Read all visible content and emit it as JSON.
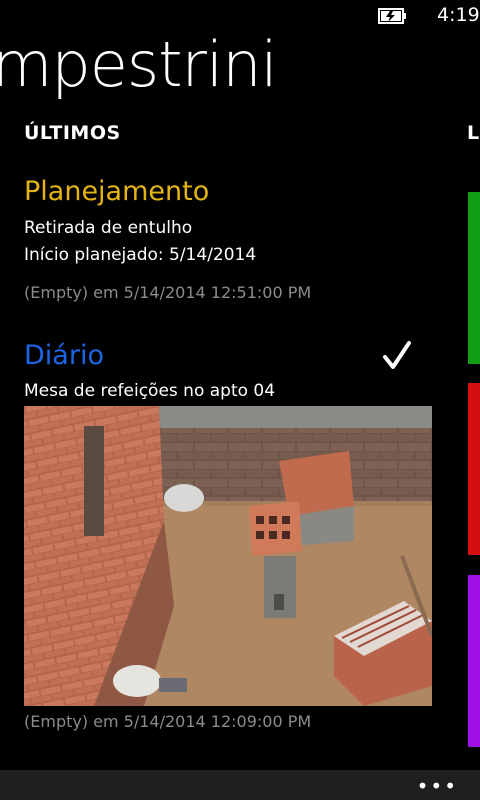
{
  "status_bar": {
    "time": "4:19",
    "battery_icon": "battery-charging-icon"
  },
  "app": {
    "title": "mpestrini"
  },
  "section": {
    "header": "ÚLTIMOS",
    "next_header_peek": "L"
  },
  "entries": [
    {
      "title": "Planejamento",
      "title_color": "#e3b412",
      "lines": [
        "Retirada de entulho",
        "Início planejado: 5/14/2014"
      ],
      "meta": "(Empty) em 5/14/2014 12:51:00 PM"
    },
    {
      "title": "Diário",
      "title_color": "#1b65e6",
      "lines": [
        "Mesa de refeições no apto 04"
      ],
      "meta": "(Empty) em 5/14/2014 12:09:00 PM",
      "checked": true,
      "photo": "construction-room-bricks-photo"
    }
  ],
  "tiles": [
    {
      "color": "#119c15"
    },
    {
      "color": "#d3100f"
    },
    {
      "color": "#9f11e7"
    }
  ],
  "app_bar": {
    "more_icon": "ellipsis-icon",
    "more_label": "•••"
  }
}
